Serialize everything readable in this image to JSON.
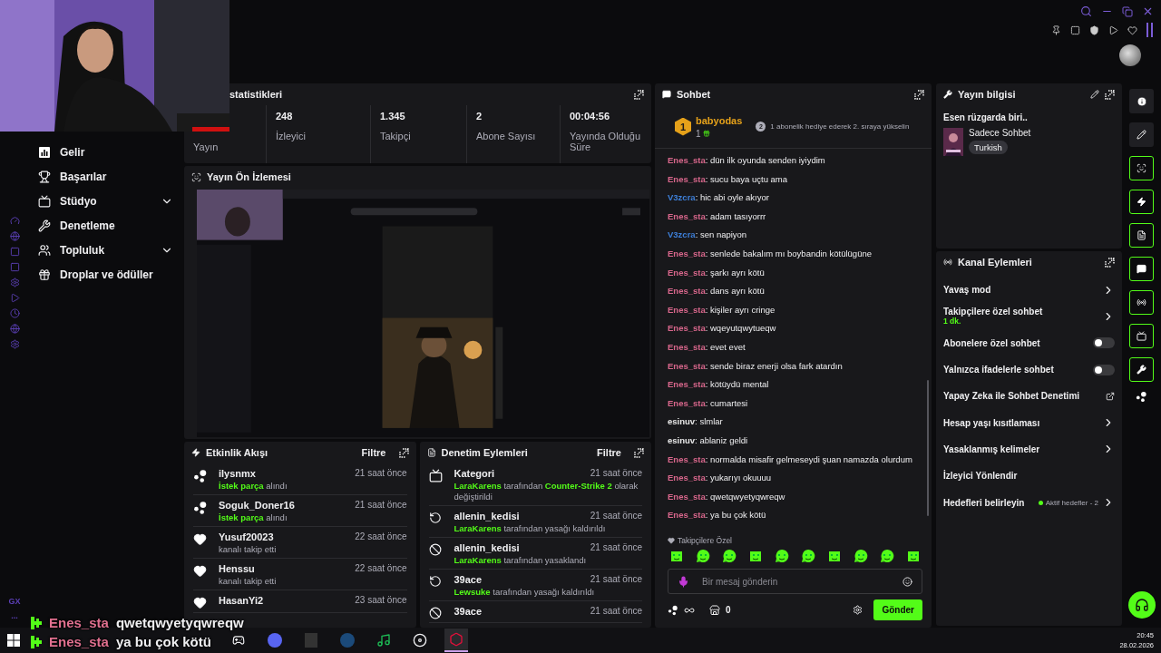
{
  "overlay_chat": [
    {
      "user": "Enes_sta",
      "text": "qwetqwyetyqwreqw"
    },
    {
      "user": "Enes_sta",
      "text": "ya bu çok kötü"
    }
  ],
  "browser_rail": {
    "label": "GX",
    "more": "..."
  },
  "nav": [
    {
      "label": "Gelir",
      "expandable": false
    },
    {
      "label": "Başarılar",
      "expandable": false
    },
    {
      "label": "Stüdyo",
      "expandable": true
    },
    {
      "label": "Denetleme",
      "expandable": false
    },
    {
      "label": "Topluluk",
      "expandable": true
    },
    {
      "label": "Droplar ve ödüller",
      "expandable": false
    }
  ],
  "stats": {
    "title": "statistikleri",
    "items": [
      {
        "label": "Yayın"
      },
      {
        "value": "248",
        "label": "İzleyici"
      },
      {
        "value": "1.345",
        "label": "Takipçi"
      },
      {
        "value": "2",
        "label": "Abone Sayısı"
      },
      {
        "value": "00:04:56",
        "label": "Yayında Olduğu Süre"
      }
    ]
  },
  "preview": {
    "title": "Yayın Ön İzlemesi",
    "kind": "picture"
  },
  "activity": {
    "title": "Etkinlik Akışı",
    "filter": "Filtre",
    "items": [
      {
        "kind": "request",
        "user": "ilysnmx",
        "time": "21 saat önce",
        "detail": "**İstek parça** alındı"
      },
      {
        "kind": "request",
        "user": "Soguk_Doner16",
        "time": "21 saat önce",
        "detail": "**İstek parça** alındı"
      },
      {
        "kind": "follow",
        "user": "Yusuf20023",
        "time": "22 saat önce",
        "detail": "kanalı takip etti"
      },
      {
        "kind": "follow",
        "user": "Henssu",
        "time": "22 saat önce",
        "detail": "kanalı takip etti"
      },
      {
        "kind": "follow",
        "user": "HasanYi2",
        "time": "23 saat önce"
      }
    ]
  },
  "moderation": {
    "title": "Denetim Eylemleri",
    "filter": "Filtre",
    "items": [
      {
        "kind": "category",
        "user": "Kategori",
        "time": "21 saat önce",
        "detail": "**LaraKarens** tarafından **Counter-Strike 2** olarak değiştirildi"
      },
      {
        "kind": "unban",
        "user": "allenin_kedisi",
        "time": "21 saat önce",
        "detail": "**LaraKarens** tarafından yasağı kaldırıldı"
      },
      {
        "kind": "ban",
        "user": "allenin_kedisi",
        "time": "21 saat önce",
        "detail": "**LaraKarens** tarafından yasaklandı"
      },
      {
        "kind": "unban",
        "user": "39ace",
        "time": "21 saat önce",
        "detail": "**Lewsuke** tarafından yasağı kaldırıldı"
      },
      {
        "kind": "ban",
        "user": "39ace",
        "time": "21 saat önce"
      }
    ]
  },
  "chat": {
    "title": "Sohbet",
    "leader": {
      "rank": "1",
      "name": "babyodas",
      "count": "1",
      "next_rank": "2",
      "hint": "1 abonelik hediye ederek 2. sıraya yükselin"
    },
    "messages": [
      {
        "user": "Enes_sta",
        "color": "#d9678c",
        "text": ": dün ilk oyunda senden iyiydim"
      },
      {
        "user": "Enes_sta",
        "color": "#d9678c",
        "text": ": sucu baya uçtu ama"
      },
      {
        "user": "V3zcra",
        "color": "#3d7fd9",
        "text": ": hic abi oyle akıyor"
      },
      {
        "user": "Enes_sta",
        "color": "#d9678c",
        "text": ": adam tasıyorrr"
      },
      {
        "user": "V3zcra",
        "color": "#3d7fd9",
        "text": ": sen napiyon"
      },
      {
        "user": "Enes_sta",
        "color": "#d9678c",
        "text": ": senlede bakalım mı boybandin kötülügüne"
      },
      {
        "user": "Enes_sta",
        "color": "#d9678c",
        "text": ": şarkı ayrı kötü"
      },
      {
        "user": "Enes_sta",
        "color": "#d9678c",
        "text": ": dans ayrı kötü"
      },
      {
        "user": "Enes_sta",
        "color": "#d9678c",
        "text": ": kişiler ayrı cringe"
      },
      {
        "user": "Enes_sta",
        "color": "#d9678c",
        "text": ": wqeyutqwytueqw"
      },
      {
        "user": "Enes_sta",
        "color": "#d9678c",
        "text": ": evet evet"
      },
      {
        "user": "Enes_sta",
        "color": "#d9678c",
        "text": ": sende biraz enerji olsa fark atardın"
      },
      {
        "user": "Enes_sta",
        "color": "#d9678c",
        "text": ": kötüydü mental"
      },
      {
        "user": "Enes_sta",
        "color": "#d9678c",
        "text": ": cumartesi"
      },
      {
        "user": "esinuv",
        "color": "#e8e8e8",
        "text": ": slmlar"
      },
      {
        "user": "esinuv",
        "color": "#e8e8e8",
        "text": ": ablaniz geldi"
      },
      {
        "user": "Enes_sta",
        "color": "#d9678c",
        "text": ": normalda misafir gelmeseydi şuan namazda olurdum"
      },
      {
        "user": "Enes_sta",
        "color": "#d9678c",
        "text": ": yukarıyı okuuuu"
      },
      {
        "user": "Enes_sta",
        "color": "#d9678c",
        "text": ": qwetqwyetyqwreqw"
      },
      {
        "user": "Enes_sta",
        "color": "#d9678c",
        "text": ": ya bu çok kötü"
      }
    ],
    "emote_label": "Takipçilere Özel",
    "placeholder": "Bir mesaj gönderin",
    "points": "0",
    "send": "Gönder"
  },
  "stream_info": {
    "title": "Yayın bilgisi",
    "stream_title": "Esen rüzgarda biri..",
    "category": "Sadece Sohbet",
    "tag": "Turkish"
  },
  "channel_actions": {
    "title": "Kanal Eylemleri",
    "items": [
      {
        "kind": "chevron",
        "label": "Yavaş mod"
      },
      {
        "kind": "chevron",
        "label": "Takipçilere özel sohbet",
        "sub": "1 dk."
      },
      {
        "kind": "toggle",
        "label": "Abonelere özel sohbet",
        "on": false
      },
      {
        "kind": "toggle",
        "label": "Yalnızca ifadelerle sohbet",
        "on": false
      },
      {
        "kind": "external",
        "label": "Yapay Zeka ile Sohbet Denetimi"
      },
      {
        "kind": "chevron",
        "label": "Hesap yaşı kısıtlaması"
      },
      {
        "kind": "chevron",
        "label": "Yasaklanmış kelimeler"
      },
      {
        "kind": "plain",
        "label": "İzleyici Yönlendir"
      },
      {
        "kind": "chevron",
        "label": "Hedefleri belirleyin",
        "status": "Aktif hedefler - 2"
      }
    ]
  },
  "taskbar": {
    "time": "20:45",
    "date": "28.02.2026"
  }
}
